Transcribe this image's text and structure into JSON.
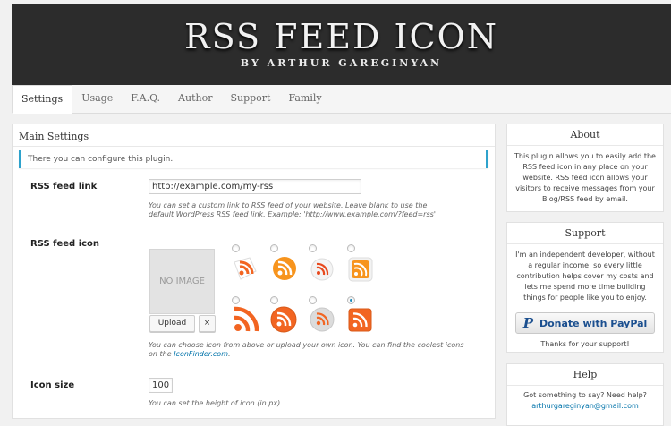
{
  "banner": {
    "title": "RSS FEED ICON",
    "subtitle": "BY ARTHUR GAREGINYAN"
  },
  "tabs": [
    {
      "label": "Settings",
      "active": true
    },
    {
      "label": "Usage"
    },
    {
      "label": "F.A.Q."
    },
    {
      "label": "Author"
    },
    {
      "label": "Support"
    },
    {
      "label": "Family"
    }
  ],
  "main": {
    "title": "Main Settings",
    "notice": "There you can configure this plugin.",
    "feed_link": {
      "label": "RSS feed link",
      "value": "http://example.com/my-rss",
      "hint": "You can set a custom link to RSS feed of your website. Leave blank to use the default WordPress RSS feed link. Example: 'http://www.example.com/?feed=rss'"
    },
    "feed_icon": {
      "label": "RSS feed icon",
      "no_image": "NO IMAGE",
      "upload_label": "Upload",
      "remove_label": "×",
      "hint_text": "You can choose icon from above or upload your own icon. You can find the coolest icons on the",
      "hint_link": "IconFinder.com",
      "hint_end": ".",
      "selected_index": 7
    },
    "icon_size": {
      "label": "Icon size",
      "value": "100",
      "hint": "You can set the height of icon (in px)."
    }
  },
  "sidebar": {
    "about": {
      "title": "About",
      "text": "This plugin allows you to easily add the RSS feed icon in any place on your website. RSS feed icon allows your visitors to receive messages from your Blog/RSS feed by email."
    },
    "support": {
      "title": "Support",
      "text": "I'm an independent developer, without a regular income, so every little contribution helps cover my costs and lets me spend more time building things for people like you to enjoy.",
      "paypal_label": "Donate with PayPal",
      "thanks": "Thanks for your support!"
    },
    "help": {
      "title": "Help",
      "text": "Got something to say? Need help?",
      "email": "arthurgareginyan@gmail.com"
    }
  },
  "colors": {
    "accent": "#2ea2cc",
    "rss_orange": "#f26522",
    "banner_bg": "#2c2c2c"
  }
}
